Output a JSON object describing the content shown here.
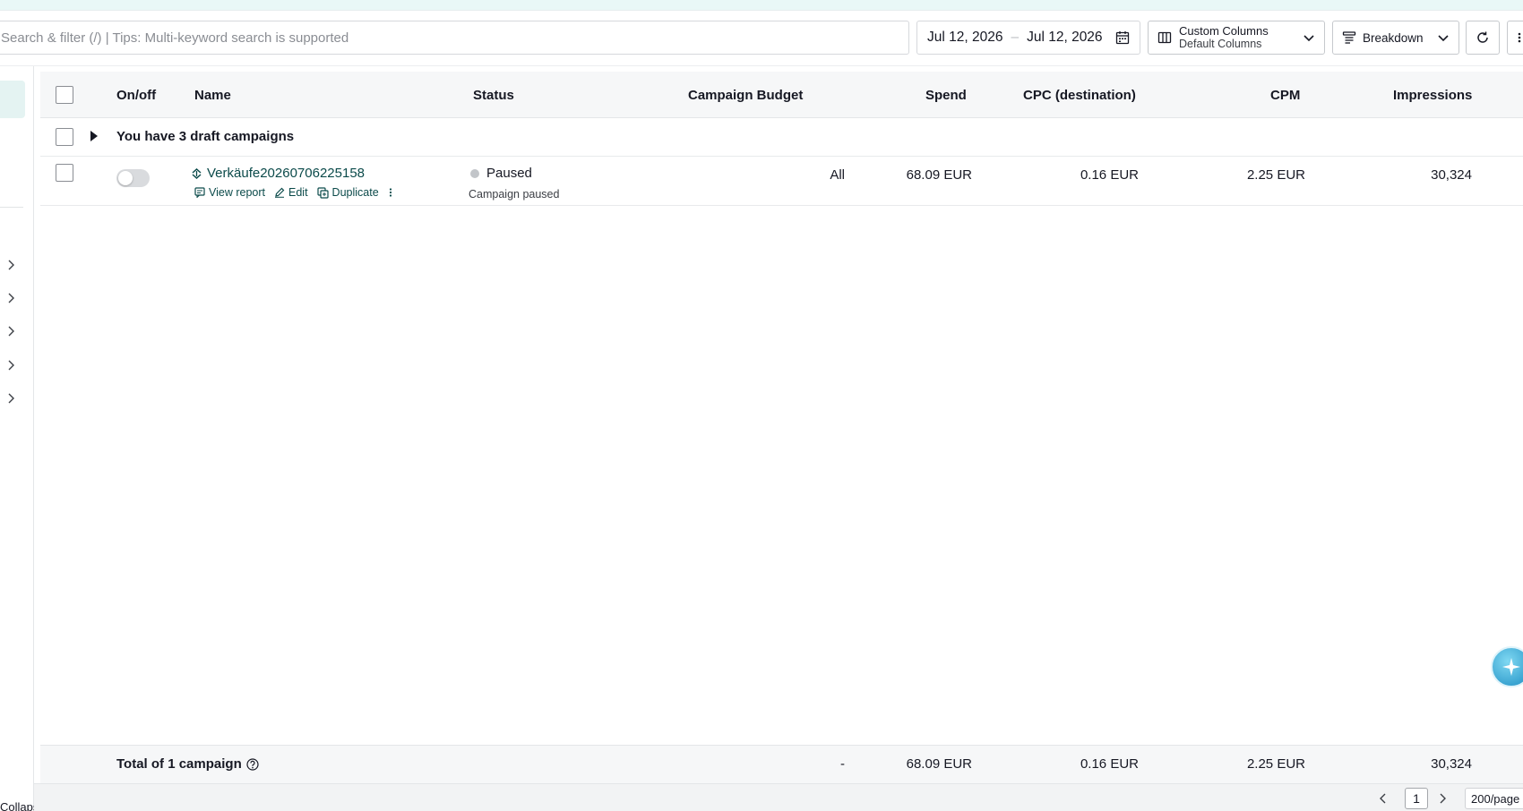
{
  "toolbar": {
    "search_placeholder": "Search & filter (/) | Tips: Multi-keyword search is supported",
    "date_start": "Jul 12, 2026",
    "date_sep": "–",
    "date_end": "Jul 12, 2026",
    "columns_label": "Custom Columns",
    "columns_value": "Default Columns",
    "breakdown_label": "Breakdown"
  },
  "table": {
    "headers": {
      "onoff": "On/off",
      "name": "Name",
      "status": "Status",
      "budget": "Campaign Budget",
      "spend": "Spend",
      "cpc": "CPC (destination)",
      "cpm": "CPM",
      "impressions": "Impressions"
    },
    "draft_label": "You have 3 draft campaigns",
    "rows": [
      {
        "name": "Verkäufe20260706225158",
        "view_report": "View report",
        "edit": "Edit",
        "duplicate": "Duplicate",
        "status": "Paused",
        "status_detail": "Campaign paused",
        "budget": "All",
        "spend": "68.09 EUR",
        "cpc": "0.16 EUR",
        "cpm": "2.25 EUR",
        "impressions": "30,324"
      }
    ],
    "footer": {
      "total_label": "Total of 1 campaign",
      "budget": "-",
      "spend": "68.09 EUR",
      "cpc": "0.16 EUR",
      "cpm": "2.25 EUR",
      "impressions": "30,324"
    }
  },
  "sidebar": {
    "collapse_label": "Collapse"
  },
  "pager": {
    "page": "1",
    "per_page": "200/page"
  },
  "colors": {
    "accent": "#0b4a4a",
    "top_strip": "#e9f8f7",
    "header_bg": "#f6f7f8"
  }
}
